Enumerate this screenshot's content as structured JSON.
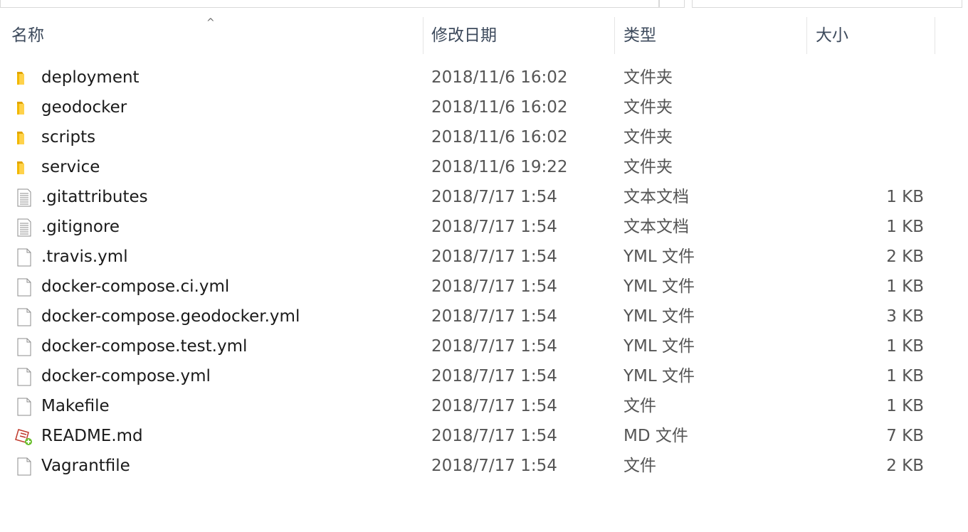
{
  "columns": {
    "name": "名称",
    "date": "修改日期",
    "type": "类型",
    "size": "大小"
  },
  "files": [
    {
      "name": "deployment",
      "date": "2018/11/6 16:02",
      "type": "文件夹",
      "size": "",
      "icon": "folder-icon"
    },
    {
      "name": "geodocker",
      "date": "2018/11/6 16:02",
      "type": "文件夹",
      "size": "",
      "icon": "folder-icon"
    },
    {
      "name": "scripts",
      "date": "2018/11/6 16:02",
      "type": "文件夹",
      "size": "",
      "icon": "folder-icon"
    },
    {
      "name": "service",
      "date": "2018/11/6 19:22",
      "type": "文件夹",
      "size": "",
      "icon": "folder-icon"
    },
    {
      "name": ".gitattributes",
      "date": "2018/7/17 1:54",
      "type": "文本文档",
      "size": "1 KB",
      "icon": "text-document-icon"
    },
    {
      "name": ".gitignore",
      "date": "2018/7/17 1:54",
      "type": "文本文档",
      "size": "1 KB",
      "icon": "text-document-icon"
    },
    {
      "name": ".travis.yml",
      "date": "2018/7/17 1:54",
      "type": "YML 文件",
      "size": "2 KB",
      "icon": "file-icon"
    },
    {
      "name": "docker-compose.ci.yml",
      "date": "2018/7/17 1:54",
      "type": "YML 文件",
      "size": "1 KB",
      "icon": "file-icon"
    },
    {
      "name": "docker-compose.geodocker.yml",
      "date": "2018/7/17 1:54",
      "type": "YML 文件",
      "size": "3 KB",
      "icon": "file-icon"
    },
    {
      "name": "docker-compose.test.yml",
      "date": "2018/7/17 1:54",
      "type": "YML 文件",
      "size": "1 KB",
      "icon": "file-icon"
    },
    {
      "name": "docker-compose.yml",
      "date": "2018/7/17 1:54",
      "type": "YML 文件",
      "size": "1 KB",
      "icon": "file-icon"
    },
    {
      "name": "Makefile",
      "date": "2018/7/17 1:54",
      "type": "文件",
      "size": "1 KB",
      "icon": "file-icon"
    },
    {
      "name": "README.md",
      "date": "2018/7/17 1:54",
      "type": "MD 文件",
      "size": "7 KB",
      "icon": "markdown-editor-icon"
    },
    {
      "name": "Vagrantfile",
      "date": "2018/7/17 1:54",
      "type": "文件",
      "size": "2 KB",
      "icon": "file-icon"
    }
  ]
}
